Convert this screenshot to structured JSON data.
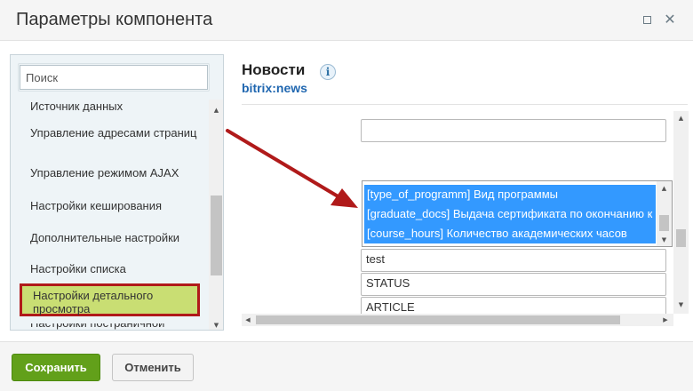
{
  "window": {
    "title": "Параметры компонента",
    "maximize_icon": "maximize-icon",
    "close_icon": "close-icon",
    "close_glyph": "✕"
  },
  "sidebar": {
    "search_placeholder": "Поиск",
    "items": [
      {
        "label": "Источник данных"
      },
      {
        "label": "Управление адресами страниц"
      },
      {
        "label": "Управление режимом AJAX"
      },
      {
        "label": "Настройки кеширования"
      },
      {
        "label": "Дополнительные настройки"
      },
      {
        "label": "Настройки списка"
      },
      {
        "label": "Настройки детального просмотра",
        "active": true
      },
      {
        "label": "Настройки постраничной навигации"
      }
    ]
  },
  "component": {
    "name": "Новости",
    "code": "bitrix:news",
    "info_glyph": "i"
  },
  "properties": {
    "selected_options": [
      "[type_of_programm] Вид программы",
      "[graduate_docs] Выдача сертификата по окончанию к",
      "[course_hours] Количество академических часов"
    ],
    "fields": [
      "test",
      "STATUS",
      "ARTICLE"
    ]
  },
  "footer": {
    "save_label": "Сохранить",
    "cancel_label": "Отменить"
  },
  "colors": {
    "accent": "#c9de73",
    "highlight_border": "#b01a1a",
    "selection": "#3399ff",
    "save_button": "#62a01a",
    "arrow": "#b01a1a"
  }
}
